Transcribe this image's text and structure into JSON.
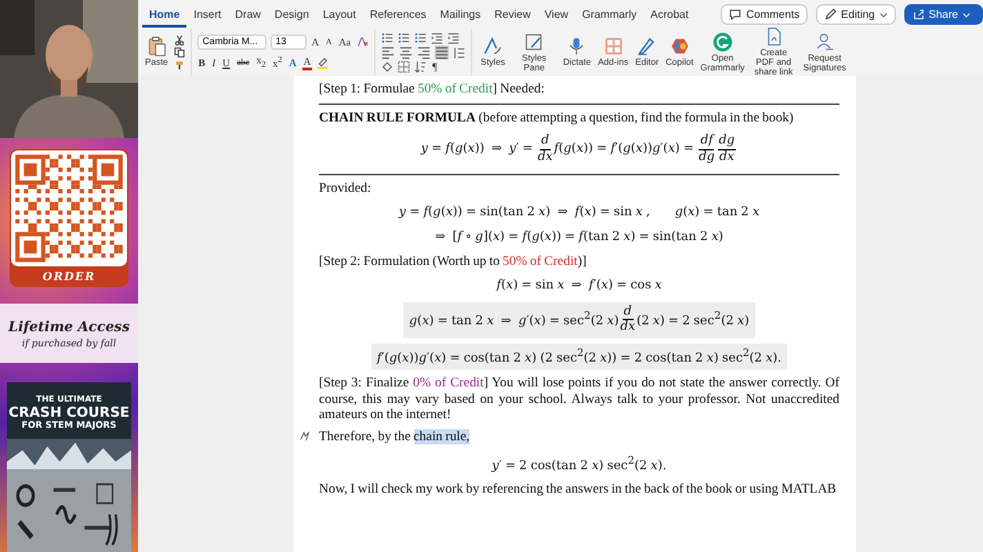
{
  "promo": {
    "order_label": "ORDER",
    "headline": "Lifetime Access",
    "subline": "if purchased by fall",
    "book_title": [
      "THE ULTIMATE",
      "CRASH COURSE",
      "FOR STEM MAJORS"
    ]
  },
  "ribbon": {
    "tabs": [
      {
        "label": "Home",
        "selected": true
      },
      {
        "label": "Insert",
        "selected": false
      },
      {
        "label": "Draw",
        "selected": false
      },
      {
        "label": "Design",
        "selected": false
      },
      {
        "label": "Layout",
        "selected": false
      },
      {
        "label": "References",
        "selected": false
      },
      {
        "label": "Mailings",
        "selected": false
      },
      {
        "label": "Review",
        "selected": false
      },
      {
        "label": "View",
        "selected": false
      },
      {
        "label": "Grammarly",
        "selected": false
      },
      {
        "label": "Acrobat",
        "selected": false
      }
    ],
    "actions": [
      {
        "kind": "comments",
        "label": "Comments"
      },
      {
        "kind": "editing",
        "label": "Editing"
      },
      {
        "kind": "share",
        "label": "Share"
      }
    ],
    "paste_label": "Paste",
    "font_name": "Cambria M...",
    "font_size": "13",
    "size_buttons": [
      {
        "kind": "grow",
        "label": "A"
      },
      {
        "kind": "shrink",
        "label": "A"
      },
      {
        "kind": "case",
        "label": "Aa"
      }
    ],
    "format_buttons": [
      {
        "kind": "bold",
        "label": "B"
      },
      {
        "kind": "italic",
        "label": "I"
      },
      {
        "kind": "underline",
        "label": "U"
      },
      {
        "kind": "strike",
        "label": "abc"
      },
      {
        "kind": "sub",
        "label": "x$_{2}$"
      },
      {
        "kind": "sup",
        "label": "x$^{2}$"
      },
      {
        "kind": "effects",
        "label": "A"
      },
      {
        "kind": "font-color",
        "label": "A"
      }
    ],
    "align_buttons": [
      {
        "kind": "left",
        "selected": false
      },
      {
        "kind": "center",
        "selected": false
      },
      {
        "kind": "right",
        "selected": false
      },
      {
        "kind": "justify",
        "selected": true
      }
    ],
    "pilcrow": "¶",
    "commands": [
      {
        "kind": "styles",
        "label": "Styles"
      },
      {
        "kind": "styles-pane",
        "label": "Styles Pane"
      },
      {
        "kind": "dictate",
        "label": "Dictate"
      },
      {
        "kind": "add-ins",
        "label": "Add-ins"
      },
      {
        "kind": "editor",
        "label": "Editor"
      },
      {
        "kind": "copilot",
        "label": "Copilot"
      },
      {
        "kind": "grammarly",
        "label": "Open Grammarly"
      },
      {
        "kind": "pdf",
        "label": "Create PDF and share link"
      },
      {
        "kind": "signatures",
        "label": "Request Signatures"
      }
    ]
  },
  "document": {
    "blocks": [
      {
        "kind": "para",
        "parts": [
          {
            "text": "[Step 1: Formulae "
          },
          {
            "text": "50% of Credit",
            "color": "#2e9e4f"
          },
          {
            "text": "] Needed:"
          }
        ]
      },
      {
        "kind": "rule"
      },
      {
        "kind": "para",
        "parts": [
          {
            "text": "**CHAIN RULE FORMULA** (before attempting a question, find the formula in  the book)"
          }
        ]
      },
      {
        "kind": "eq",
        "shaded": false,
        "parts": [
          {
            "kind": "text",
            "text": "*y* = *f*(*g*(*x*))  ⇒  *y*′ = "
          },
          {
            "kind": "frac",
            "num": "*d*",
            "den": "*dx*"
          },
          {
            "kind": "text",
            "text": "*f*(*g*(*x*)) = *f*′(*g*(*x*))*g*′(*x*) = "
          },
          {
            "kind": "frac",
            "num": "*df*",
            "den": "*dg*"
          },
          {
            "kind": "frac",
            "num": "*dg*",
            "den": "*dx*"
          }
        ]
      },
      {
        "kind": "rule"
      },
      {
        "kind": "para",
        "parts": [
          {
            "text": "Provided:"
          }
        ]
      },
      {
        "kind": "eq",
        "shaded": false,
        "parts": [
          {
            "kind": "text",
            "text": "*y* = *f*(*g*(*x*)) = sin(tan 2 *x*)  ⇒  *f*(*x*) = sin *x* ,       *g*(*x*) = tan 2 *x*"
          }
        ]
      },
      {
        "kind": "eq",
        "shaded": false,
        "parts": [
          {
            "kind": "text",
            "text": "⇒  [*f* ∘ *g*](*x*) = *f*(*g*(*x*)) = *f*(tan 2 *x*) = sin(tan 2 *x*)"
          }
        ]
      },
      {
        "kind": "para",
        "parts": [
          {
            "text": "[Step 2: Formulation (Worth up to "
          },
          {
            "text": "50% of Credit",
            "color": "#d32f2f"
          },
          {
            "text": ")]"
          }
        ]
      },
      {
        "kind": "eq",
        "shaded": false,
        "parts": [
          {
            "kind": "text",
            "text": "*f*(*x*) = sin *x*  ⇒  *f*′(*x*) = cos *x*"
          }
        ]
      },
      {
        "kind": "eq",
        "shaded": true,
        "parts": [
          {
            "kind": "text",
            "text": "*g*(*x*) = tan 2 *x*  ⇒  *g*′(*x*) = sec$^{2}$(2 *x*)"
          },
          {
            "kind": "frac",
            "num": "*d*",
            "den": "*dx*"
          },
          {
            "kind": "text",
            "text": "(2 *x*) = 2 sec$^{2}$(2 *x*)"
          }
        ]
      },
      {
        "kind": "eq",
        "shaded": true,
        "parts": [
          {
            "kind": "text",
            "text": "*f*′(*g*(*x*))*g*′(*x*) = cos(tan 2 *x*) (2 sec$^{2}$(2 *x*)) = 2 cos(tan 2 *x*) sec$^{2}$(2 *x*)."
          }
        ]
      },
      {
        "kind": "para",
        "parts": [
          {
            "text": "[Step 3: Finalize "
          },
          {
            "text": "0% of Credit",
            "color": "#9c2a8c"
          },
          {
            "text": "] You will lose points if you do not state the answer correctly. Of course, this may vary based on your school. Always talk to your professor. Not unaccredited amateurs on the internet!"
          }
        ]
      },
      {
        "kind": "para",
        "marker": true,
        "parts": [
          {
            "text": "Therefore, by the ",
            "highlighted": false
          },
          {
            "text": "chain rule,",
            "highlighted": true
          }
        ]
      },
      {
        "kind": "eq",
        "shaded": false,
        "parts": [
          {
            "kind": "text",
            "text": "*y*′ = 2 cos(tan 2 *x*) sec$^{2}$(2 *x*)."
          }
        ]
      },
      {
        "kind": "para",
        "parts": [
          {
            "text": "Now, I will check my work by referencing the answers in the back of the book or using MATLAB"
          }
        ]
      }
    ]
  }
}
